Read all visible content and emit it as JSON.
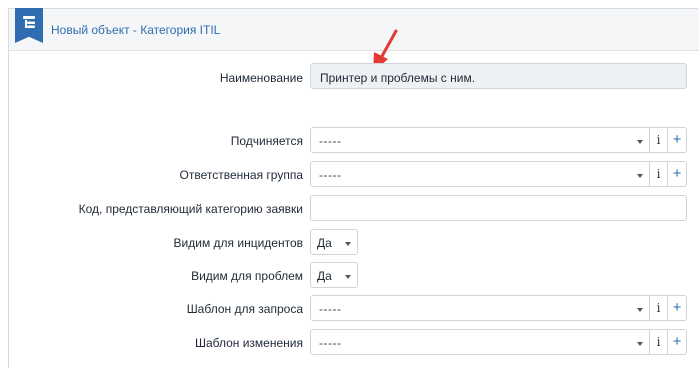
{
  "header": {
    "title": "Новый объект - Категория ITIL"
  },
  "form": {
    "name": {
      "label": "Наименование",
      "value": "Принтер и проблемы с ним."
    },
    "parent": {
      "label": "Подчиняется",
      "value": "-----"
    },
    "group": {
      "label": "Ответственная группа",
      "value": "-----"
    },
    "code": {
      "label": "Код, представляющий категорию заявки",
      "value": ""
    },
    "visible_incidents": {
      "label": "Видим для инцидентов",
      "value": "Да"
    },
    "visible_problems": {
      "label": "Видим для проблем",
      "value": "Да"
    },
    "request_template": {
      "label": "Шаблон для запроса",
      "value": "-----"
    },
    "change_template": {
      "label": "Шаблон изменения",
      "value": "-----"
    }
  },
  "buttons": {
    "info": "i",
    "add": "+"
  },
  "icons": {
    "header_icon": "hierarchy-icon",
    "arrow": "red-arrow-icon",
    "info": "info-icon",
    "add": "plus-icon",
    "dropdown": "chevron-down-icon"
  },
  "colors": {
    "accent": "#2f6db0",
    "arrow": "#e53935",
    "header_bg": "#f5f6f7"
  }
}
